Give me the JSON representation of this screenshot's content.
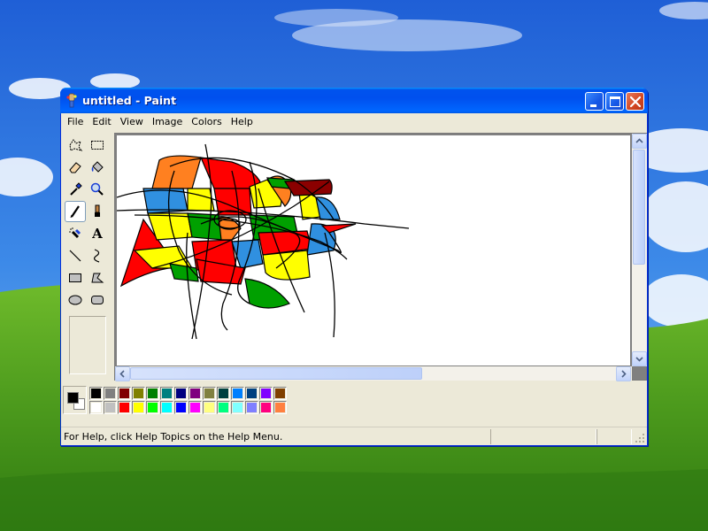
{
  "window": {
    "title": "untitled - Paint",
    "controls": {
      "minimize_icon": "minimize-icon",
      "maximize_icon": "maximize-icon",
      "close_icon": "close-icon"
    }
  },
  "menu": [
    "File",
    "Edit",
    "View",
    "Image",
    "Colors",
    "Help"
  ],
  "toolbox": {
    "selected_tool": "pencil",
    "tools": [
      "free-form-select",
      "select",
      "eraser",
      "fill-with-color",
      "pick-color",
      "magnifier",
      "pencil",
      "brush",
      "airbrush",
      "text",
      "line",
      "curve",
      "rectangle",
      "polygon",
      "ellipse",
      "rounded-rectangle"
    ],
    "text_tool_glyph": "A"
  },
  "colors": {
    "foreground": "#000000",
    "background": "#ffffff",
    "palette_top": [
      "#000000",
      "#808080",
      "#800000",
      "#808000",
      "#008000",
      "#008080",
      "#000080",
      "#800080",
      "#808040",
      "#004040",
      "#0080ff",
      "#004080",
      "#8000ff",
      "#804000"
    ],
    "palette_bottom": [
      "#ffffff",
      "#c0c0c0",
      "#ff0000",
      "#ffff00",
      "#00ff00",
      "#00ffff",
      "#0000ff",
      "#ff00ff",
      "#ffff80",
      "#00ff80",
      "#80ffff",
      "#8080ff",
      "#ff0080",
      "#ff8040"
    ]
  },
  "drawing": {
    "fill_colors": [
      "#ff0000",
      "#ffff00",
      "#00a000",
      "#3090e0",
      "#ff8020",
      "#8b0000"
    ]
  },
  "status": {
    "help_text": "For Help, click Help Topics on the Help Menu."
  }
}
